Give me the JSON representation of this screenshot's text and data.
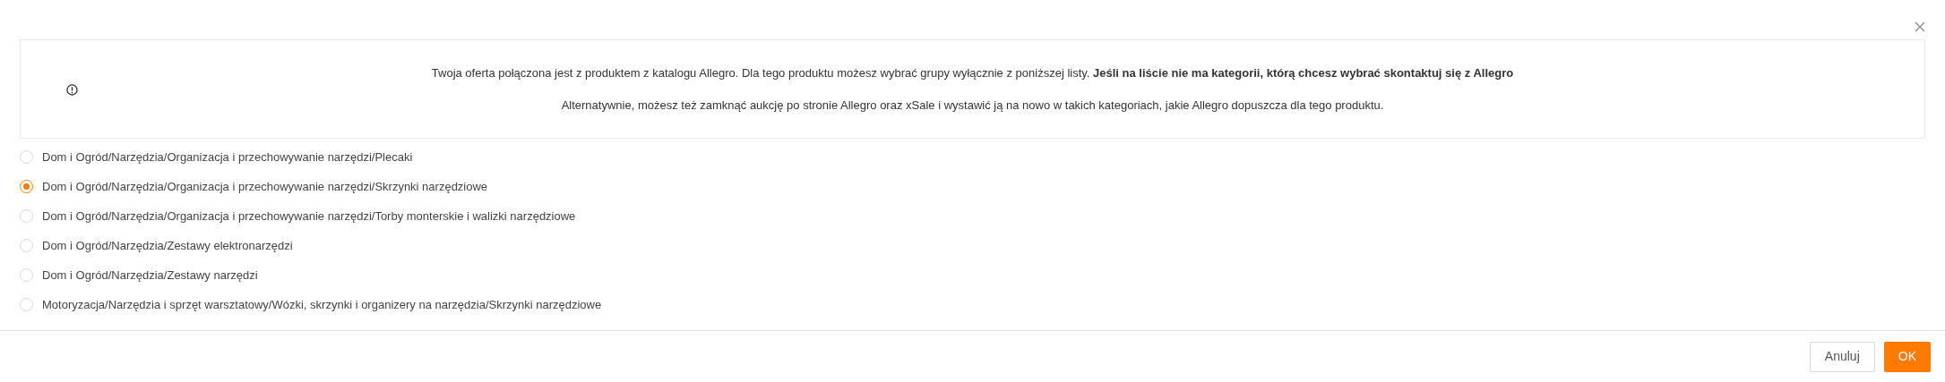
{
  "info": {
    "lines": [
      "Twoja oferta połączona jest z produktem z katalogu Allegro. Dla tego produktu możesz wybrać grupy wyłącznie z poniższej listy. **Jeśli na liście nie ma kategorii, którą chcesz wybrać skontaktuj się z Allegro**",
      "Alternatywnie, możesz też zamknąć aukcję po stronie Allegro oraz xSale i wystawić ją na nowo w takich kategoriach, jakie Allegro dopuszcza dla tego produktu."
    ]
  },
  "options": [
    {
      "label": "Dom i Ogród/Narzędzia/Organizacja i przechowywanie narzędzi/Plecaki",
      "selected": false
    },
    {
      "label": "Dom i Ogród/Narzędzia/Organizacja i przechowywanie narzędzi/Skrzynki narzędziowe",
      "selected": true
    },
    {
      "label": "Dom i Ogród/Narzędzia/Organizacja i przechowywanie narzędzi/Torby monterskie i walizki narzędziowe",
      "selected": false
    },
    {
      "label": "Dom i Ogród/Narzędzia/Zestawy elektronarzędzi",
      "selected": false
    },
    {
      "label": "Dom i Ogród/Narzędzia/Zestawy narzędzi",
      "selected": false
    },
    {
      "label": "Motoryzacja/Narzędzia i sprzęt warsztatowy/Wózki, skrzynki i organizery na narzędzia/Skrzynki narzędziowe",
      "selected": false
    }
  ],
  "buttons": [
    {
      "label": "Anuluj",
      "kind": "secondary"
    },
    {
      "label": "OK",
      "kind": "primary"
    }
  ]
}
